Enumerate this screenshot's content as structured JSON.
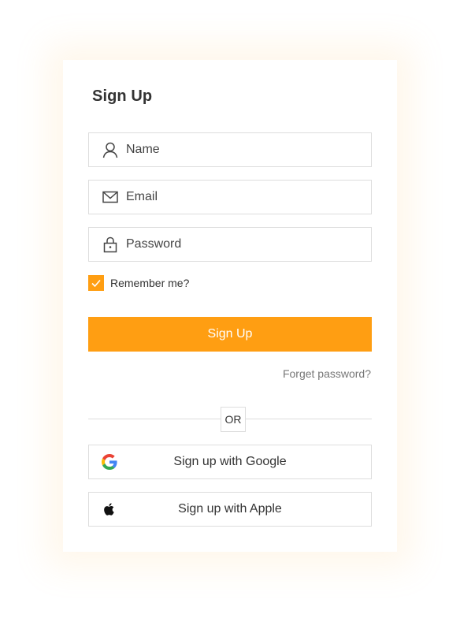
{
  "form": {
    "title": "Sign Up",
    "name_placeholder": "Name",
    "email_placeholder": "Email",
    "password_placeholder": "Password",
    "remember_label": "Remember me?",
    "remember_checked": true,
    "submit_label": "Sign Up",
    "forgot_label": "Forget password?",
    "divider_label": "OR"
  },
  "social": {
    "google_label": "Sign up with Google",
    "apple_label": "Sign up with Apple"
  },
  "icons": {
    "name": "user-icon",
    "email": "mail-icon",
    "password": "lock-icon",
    "checkbox": "check-icon",
    "google": "google-icon",
    "apple": "apple-icon"
  },
  "colors": {
    "accent": "#ff9e12",
    "border": "#dddddd",
    "text": "#333333",
    "muted": "#777777"
  }
}
